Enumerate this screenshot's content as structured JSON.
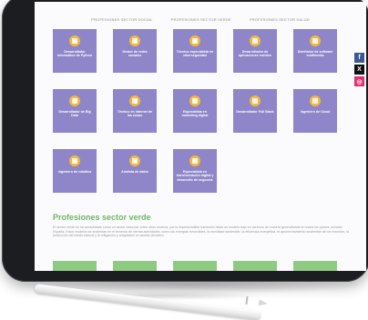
{
  "topnav": {
    "items": [
      "Profesiones sector social",
      "Profesiones sector verde",
      "Profesiones sector salud"
    ]
  },
  "tiles": [
    {
      "label": "Desarrollador informático de Python"
    },
    {
      "label": "Gestor de redes sociales"
    },
    {
      "label": "Técnico especialista en ciberseguridad"
    },
    {
      "label": "Desarrollador de aplicaciones móviles"
    },
    {
      "label": "Diseñador de software multimedia"
    },
    {
      "label": "Desarrollador de Big Data"
    },
    {
      "label": "Técnico en Internet de las cosas"
    },
    {
      "label": "Especialista en marketing digital"
    },
    {
      "label": "Desarrollador Full Stack"
    },
    {
      "label": "Ingeniero de Cloud"
    },
    {
      "label": "Ingeniero de robótica"
    },
    {
      "label": "Analista de datos"
    },
    {
      "label": "Especialista en transformación digital y desarrollo de negocios"
    }
  ],
  "green_section": {
    "title": "Profesiones sector verde",
    "text": "El sector verde se ha consolidado como un sector esencial, entre otros motivos, por la imprescindible transición hacia un modelo bajo en carbono de manera generalizada en todos los países, incluido España. Estos modelos se sustentan en el fomento de ciertas actividades, como las energías renovables, la movilidad sostenible, la eficiencia energética, el aprovechamiento sostenible de los recursos, la protección del medio natural y la mitigación y adaptación al cambio climático."
  },
  "social": {
    "facebook_glyph": "f",
    "twitter_glyph": "X",
    "instagram_glyph": "◎",
    "facebook_color": "#3b5998",
    "twitter_color": "#111111",
    "instagram_color": "#e1306c"
  },
  "colors": {
    "tile": "#8e86c9",
    "icon": "#f5b83d",
    "green": "#72b566"
  }
}
